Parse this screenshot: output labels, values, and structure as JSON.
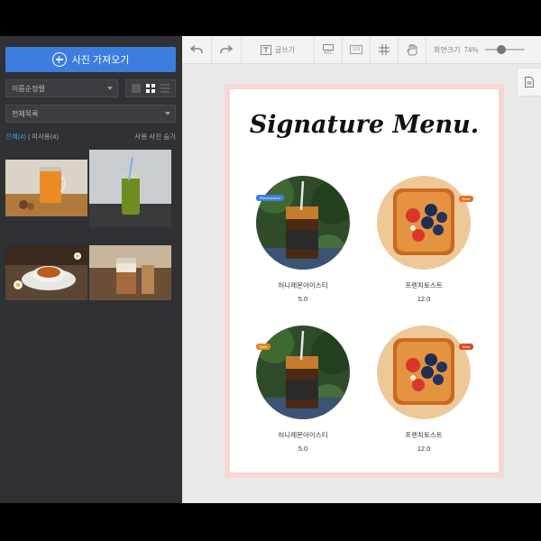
{
  "left_panel": {
    "import_button": "사진 가져오기",
    "sort_select": "이름순정렬",
    "folder_select": "전체목록",
    "filter": {
      "all": "전체(4)",
      "separator": "|",
      "unused": "미사용(4)",
      "hide_used": "사용 사진 숨기"
    }
  },
  "toolbar": {
    "text_tool": "글쓰기",
    "abc_label": "ABC",
    "num_label": "123",
    "zoom_label": "화면크기",
    "zoom_value": "74%",
    "zoom_level": 0.74
  },
  "page": {
    "title": "Signature Menu.",
    "items": [
      {
        "name": "허니레몬아이스티",
        "price": "5.0",
        "badge": "Recommend",
        "badge_color": "#3d7de0"
      },
      {
        "name": "프렌치토스트",
        "price": "12.0",
        "badge": "Best",
        "badge_color": "#e0731e"
      },
      {
        "name": "허니레몬아이스티",
        "price": "5.0",
        "badge": "New",
        "badge_color": "#e08a1e"
      },
      {
        "name": "프렌치토스트",
        "price": "12.0",
        "badge": "Best",
        "badge_color": "#d9501e"
      }
    ]
  },
  "colors": {
    "accent": "#3d7de0",
    "panel_bg": "#2f3134",
    "page_border": "#f7d6d3"
  }
}
